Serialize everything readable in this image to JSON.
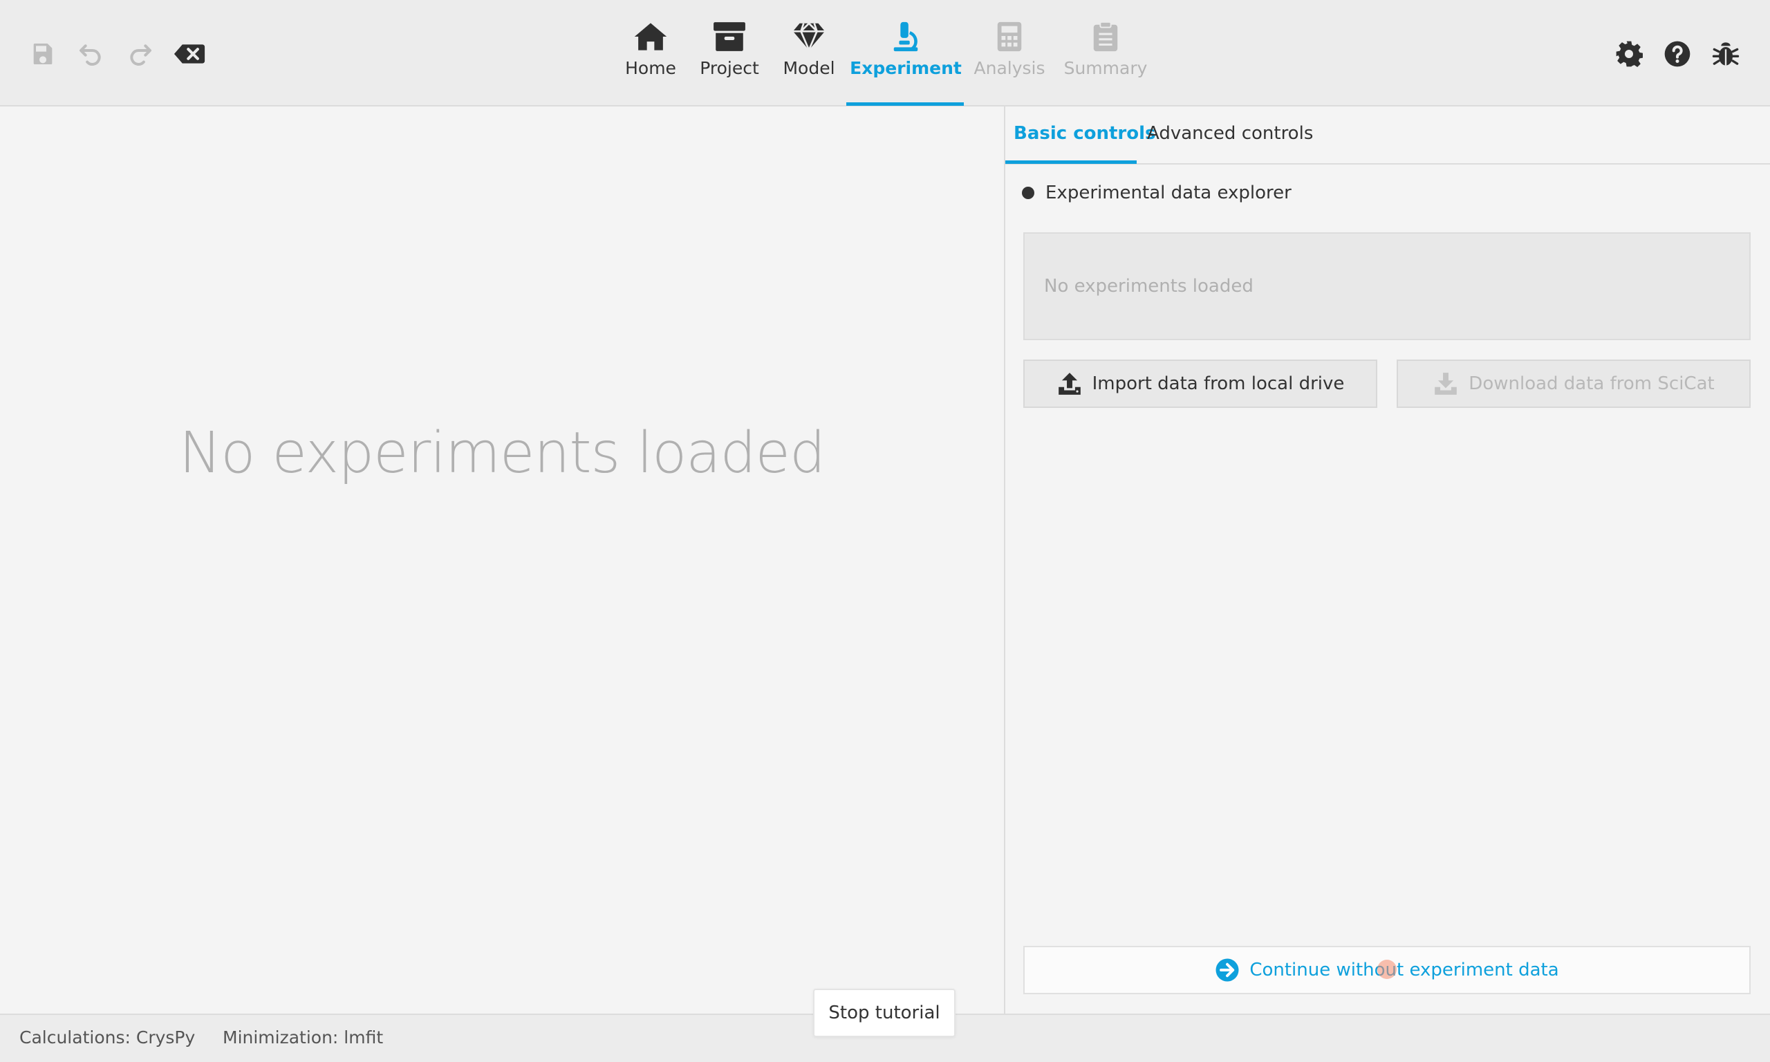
{
  "toolbar": {
    "left_icons": [
      "save-icon",
      "undo-icon",
      "redo-icon",
      "clear-icon"
    ],
    "right_icons": [
      "settings-icon",
      "help-icon",
      "bug-report-icon"
    ]
  },
  "nav": {
    "tabs": [
      {
        "label": "Home",
        "icon": "home-icon",
        "state": "normal"
      },
      {
        "label": "Project",
        "icon": "archive-icon",
        "state": "normal"
      },
      {
        "label": "Model",
        "icon": "gem-icon",
        "state": "normal"
      },
      {
        "label": "Experiment",
        "icon": "microscope-icon",
        "state": "active"
      },
      {
        "label": "Analysis",
        "icon": "calculator-icon",
        "state": "disabled"
      },
      {
        "label": "Summary",
        "icon": "clipboard-icon",
        "state": "disabled"
      }
    ]
  },
  "main": {
    "placeholder": "No experiments loaded"
  },
  "side": {
    "tabs": [
      {
        "label": "Basic controls",
        "active": true
      },
      {
        "label": "Advanced controls",
        "active": false
      }
    ],
    "group_title": "Experimental data explorer",
    "explorer_placeholder": "No experiments loaded",
    "import_button": "Import data from local drive",
    "download_button": "Download data from SciCat",
    "continue_button": "Continue without experiment data"
  },
  "tutorial": {
    "stop_label": "Stop tutorial"
  },
  "status": {
    "calculations": "Calculations: CrysPy",
    "minimization": "Minimization: lmfit"
  },
  "colors": {
    "accent": "#0ea0dc",
    "background": "#f4f4f4",
    "disabled_text": "#b4b4b4"
  }
}
